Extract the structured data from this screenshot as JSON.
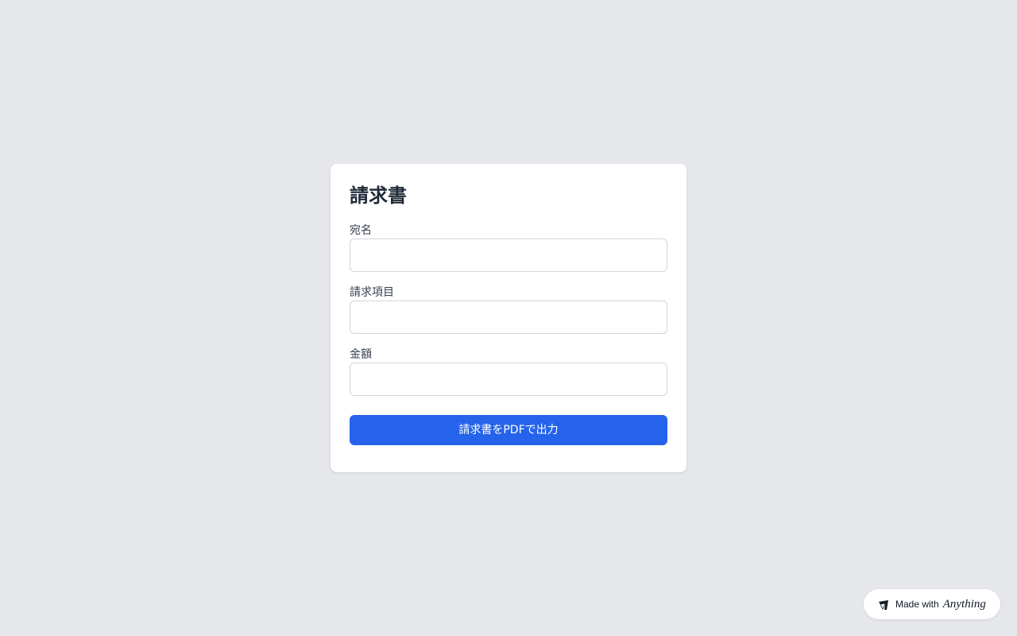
{
  "form": {
    "title": "請求書",
    "fields": [
      {
        "label": "宛名",
        "value": "",
        "placeholder": ""
      },
      {
        "label": "請求項目",
        "value": "",
        "placeholder": ""
      },
      {
        "label": "金額",
        "value": "",
        "placeholder": ""
      }
    ],
    "submit_label": "請求書をPDFで出力"
  },
  "badge": {
    "text": "Made with",
    "brand": "Anything",
    "icon": "anything-logo-icon"
  },
  "colors": {
    "background": "#e5e7eb",
    "card": "#ffffff",
    "primary": "#2563eb"
  }
}
